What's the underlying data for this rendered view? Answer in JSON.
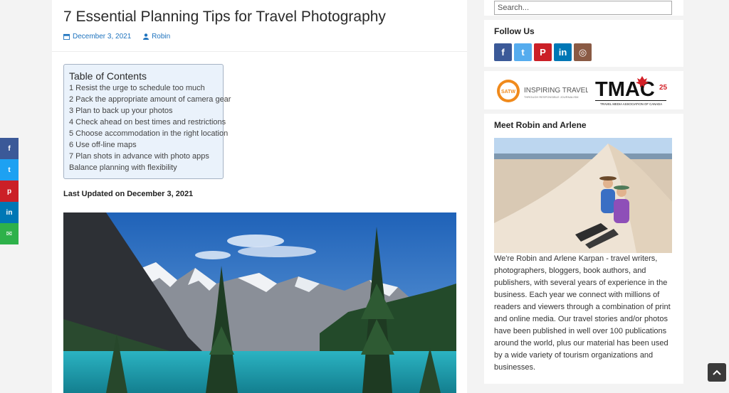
{
  "article": {
    "title": "7 Essential Planning Tips for Travel Photography",
    "date": "December 3, 2021",
    "author": "Robin",
    "last_updated": "Last Updated on December 3, 2021"
  },
  "toc": {
    "title": "Table of Contents",
    "items": [
      "1 Resist the urge to schedule too much",
      "2 Pack the appropriate amount of camera gear",
      "3 Plan to back up your photos",
      "4  Check ahead on best times and restrictions",
      "5  Choose accommodation in the right location",
      "6  Use off-line maps",
      "7  Plan shots in advance with photo apps",
      "Balance planning with flexibility"
    ]
  },
  "share": [
    {
      "icon": "facebook-icon",
      "glyph": "f",
      "color": "#3b5998"
    },
    {
      "icon": "twitter-icon",
      "glyph": "t",
      "color": "#1da1f2"
    },
    {
      "icon": "pinterest-icon",
      "glyph": "p",
      "color": "#cb2027"
    },
    {
      "icon": "linkedin-icon",
      "glyph": "in",
      "color": "#0077b5"
    },
    {
      "icon": "email-icon",
      "glyph": "✉",
      "color": "#2eb14a"
    }
  ],
  "sidebar": {
    "search_placeholder": "Search...",
    "follow_title": "Follow Us",
    "social": [
      {
        "icon": "facebook-icon",
        "glyph": "f",
        "color": "#3b5998"
      },
      {
        "icon": "twitter-icon",
        "glyph": "t",
        "color": "#55acee"
      },
      {
        "icon": "pinterest-icon",
        "glyph": "P",
        "color": "#cb2027"
      },
      {
        "icon": "linkedin-icon",
        "glyph": "in",
        "color": "#0077b5"
      },
      {
        "icon": "instagram-icon",
        "glyph": "◎",
        "color": "#8a5a44"
      }
    ],
    "satw_logo": {
      "badge": "SATW",
      "name": "INSPIRING TRAVEL",
      "tagline": "THROUGH RESPONSIBLE JOURNALISM"
    },
    "tmac_logo": {
      "name": "TMAC",
      "years": "25",
      "tagline": "TRAVEL MEDIA ASSOCIATION OF CANADA"
    },
    "meet_title": "Meet Robin and Arlene",
    "bio": "We're Robin and Arlene Karpan - travel writers, photographers, bloggers, book authors, and publishers, with several years of experience in the business. Each year we connect with millions of readers and viewers through a combination of print and online media. Our travel stories and/or photos have been published in well over 100 publications around the world, plus our material has been used by a wide variety of tourism organizations and businesses."
  },
  "colors": {
    "link": "#1e73be",
    "toc_bg": "#eaf2fb"
  }
}
